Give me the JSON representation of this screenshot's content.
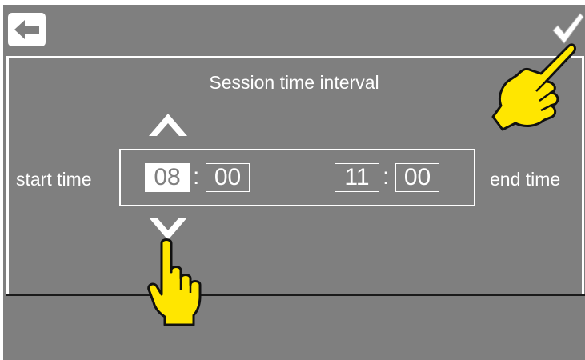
{
  "header": {
    "back_icon": "arrow-left-icon",
    "confirm_icon": "checkmark-icon"
  },
  "title": "Session time interval",
  "start": {
    "label": "start time",
    "hours": "08",
    "minutes": "00"
  },
  "end": {
    "label": "end time",
    "hours": "11",
    "minutes": "00"
  },
  "separator": ":",
  "controls": {
    "increase_icon": "chevron-up-icon",
    "decrease_icon": "chevron-down-icon"
  },
  "overlays": {
    "hand_icon": "pointing-hand-icon",
    "hand_color": "#ffe600"
  },
  "colors": {
    "screen_background": "#7f7f7f",
    "foreground": "#ffffff"
  }
}
